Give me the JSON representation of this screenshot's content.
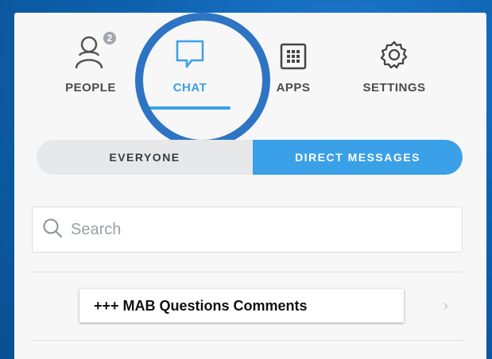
{
  "tabs": {
    "people": {
      "label": "PEOPLE",
      "badge": "2",
      "icon": "people-icon"
    },
    "chat": {
      "label": "CHAT",
      "icon": "chat-bubble-icon",
      "active": true
    },
    "apps": {
      "label": "APPS",
      "icon": "apps-grid-icon"
    },
    "settings": {
      "label": "SETTINGS",
      "icon": "gear-icon"
    }
  },
  "segment": {
    "everyone": "EVERYONE",
    "direct_messages": "DIRECT MESSAGES",
    "selected": "direct_messages"
  },
  "search": {
    "placeholder": "Search",
    "value": ""
  },
  "list": {
    "items": [
      {
        "title": "+++ MAB Questions Comments"
      }
    ]
  },
  "colors": {
    "accent": "#3aa0e8",
    "background": "#0d62ae",
    "highlight_ring": "#2d74c4"
  }
}
